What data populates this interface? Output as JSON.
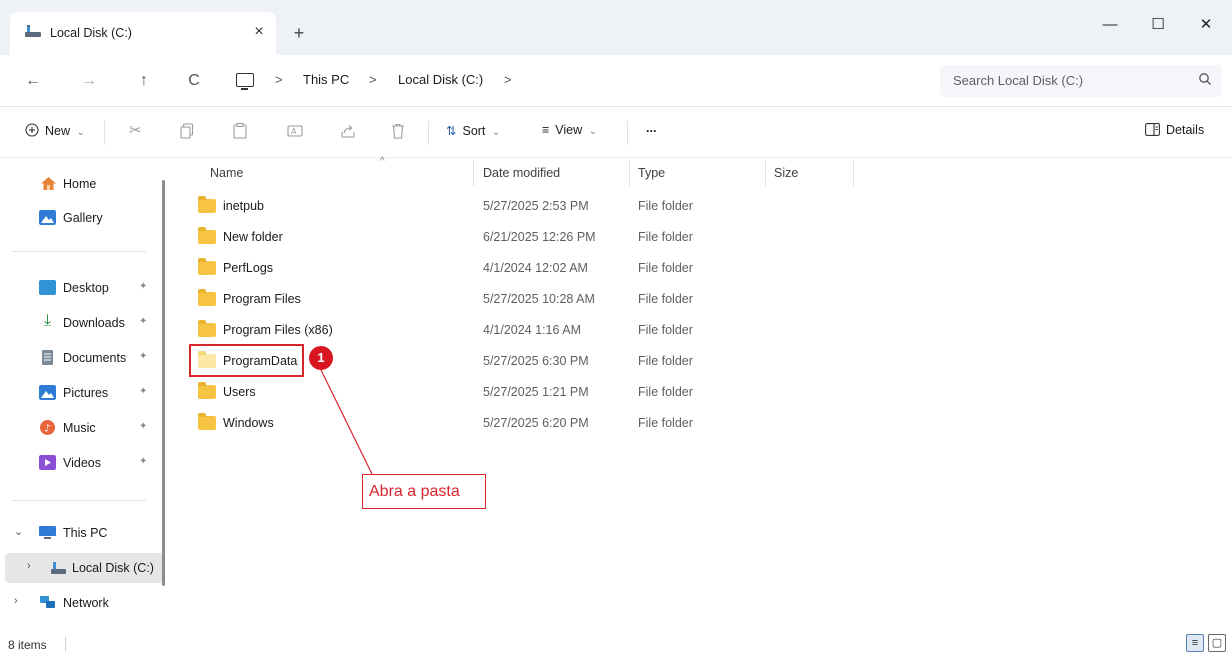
{
  "window": {
    "tab_title": "Local Disk (C:)",
    "tab_close": "×",
    "new_tab": "+",
    "minimize": "—",
    "maximize": "☐",
    "close": "✕"
  },
  "nav": {
    "back": "←",
    "forward": "→",
    "up": "↑",
    "refresh": "C",
    "breadcrumb": [
      "This PC",
      "Local Disk (C:)"
    ],
    "crumb_sep": ">",
    "search_placeholder": "Search Local Disk (C:)",
    "search_icon": "magnifier-icon"
  },
  "commandbar": {
    "new_label": "New",
    "sort_label": "Sort",
    "view_label": "View",
    "more_label": "...",
    "details_label": "Details",
    "dropdown_caret": "⌄"
  },
  "sidebar": {
    "items": [
      {
        "label": "Home",
        "icon": "home-icon",
        "color": "#e8833a"
      },
      {
        "label": "Gallery",
        "icon": "gallery-icon",
        "color": "#2f7bd6"
      },
      {
        "label": "Desktop",
        "icon": "desktop-icon",
        "color": "#2f93d6",
        "pinned": true
      },
      {
        "label": "Downloads",
        "icon": "downloads-icon",
        "color": "#1f8a3c",
        "pinned": true
      },
      {
        "label": "Documents",
        "icon": "documents-icon",
        "color": "#7d8a99",
        "pinned": true
      },
      {
        "label": "Pictures",
        "icon": "pictures-icon",
        "color": "#2f7bd6",
        "pinned": true
      },
      {
        "label": "Music",
        "icon": "music-icon",
        "color": "#e8663a",
        "pinned": true
      },
      {
        "label": "Videos",
        "icon": "videos-icon",
        "color": "#8a4fd6",
        "pinned": true
      },
      {
        "label": "This PC",
        "icon": "this-pc-icon",
        "color": "#2f7bd6"
      },
      {
        "label": "Local Disk (C:)",
        "icon": "drive-icon",
        "color": "#3a6ea5"
      },
      {
        "label": "Network",
        "icon": "network-icon",
        "color": "#2f93d6"
      }
    ],
    "pin_glyph": "📌",
    "expand_glyph": "›",
    "collapse_glyph": "⌄"
  },
  "filelist": {
    "columns": [
      "Name",
      "Date modified",
      "Type",
      "Size"
    ],
    "sort_caret": "^",
    "rows": [
      {
        "name": "inetpub",
        "date": "5/27/2025 2:53 PM",
        "type": "File folder"
      },
      {
        "name": "New folder",
        "date": "6/21/2025 12:26 PM",
        "type": "File folder"
      },
      {
        "name": "PerfLogs",
        "date": "4/1/2024 12:02 AM",
        "type": "File folder"
      },
      {
        "name": "Program Files",
        "date": "5/27/2025 10:28 AM",
        "type": "File folder"
      },
      {
        "name": "Program Files (x86)",
        "date": "4/1/2024 1:16 AM",
        "type": "File folder"
      },
      {
        "name": "ProgramData",
        "date": "5/27/2025 6:30 PM",
        "type": "File folder"
      },
      {
        "name": "Users",
        "date": "5/27/2025 1:21 PM",
        "type": "File folder"
      },
      {
        "name": "Windows",
        "date": "5/27/2025 6:20 PM",
        "type": "File folder"
      }
    ]
  },
  "annotation": {
    "badge": "1",
    "callout": "Abra a pasta",
    "color": "#d9262c"
  },
  "status": {
    "item_count": "8 items"
  }
}
